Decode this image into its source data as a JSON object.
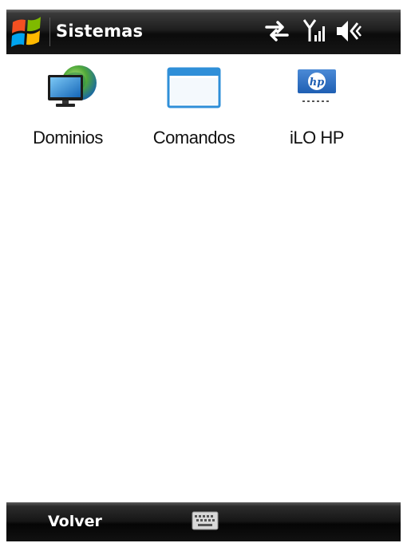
{
  "title_bar": {
    "title": "Sistemas",
    "start_icon": "windows-flag-icon",
    "status_icons": [
      "connectivity-arrows-icon",
      "signal-strength-icon",
      "volume-icon"
    ]
  },
  "apps": [
    {
      "label": "Dominios",
      "icon": "monitor-globe-icon"
    },
    {
      "label": "Comandos",
      "icon": "window-icon"
    },
    {
      "label": "iLO HP",
      "icon": "hp-logo-icon"
    }
  ],
  "softkeys": {
    "left_label": "Volver",
    "keyboard_icon": "keyboard-icon"
  },
  "colors": {
    "bar_dark": "#111111",
    "hp_blue": "#1f5fb3",
    "window_blue": "#2f8fd8"
  }
}
